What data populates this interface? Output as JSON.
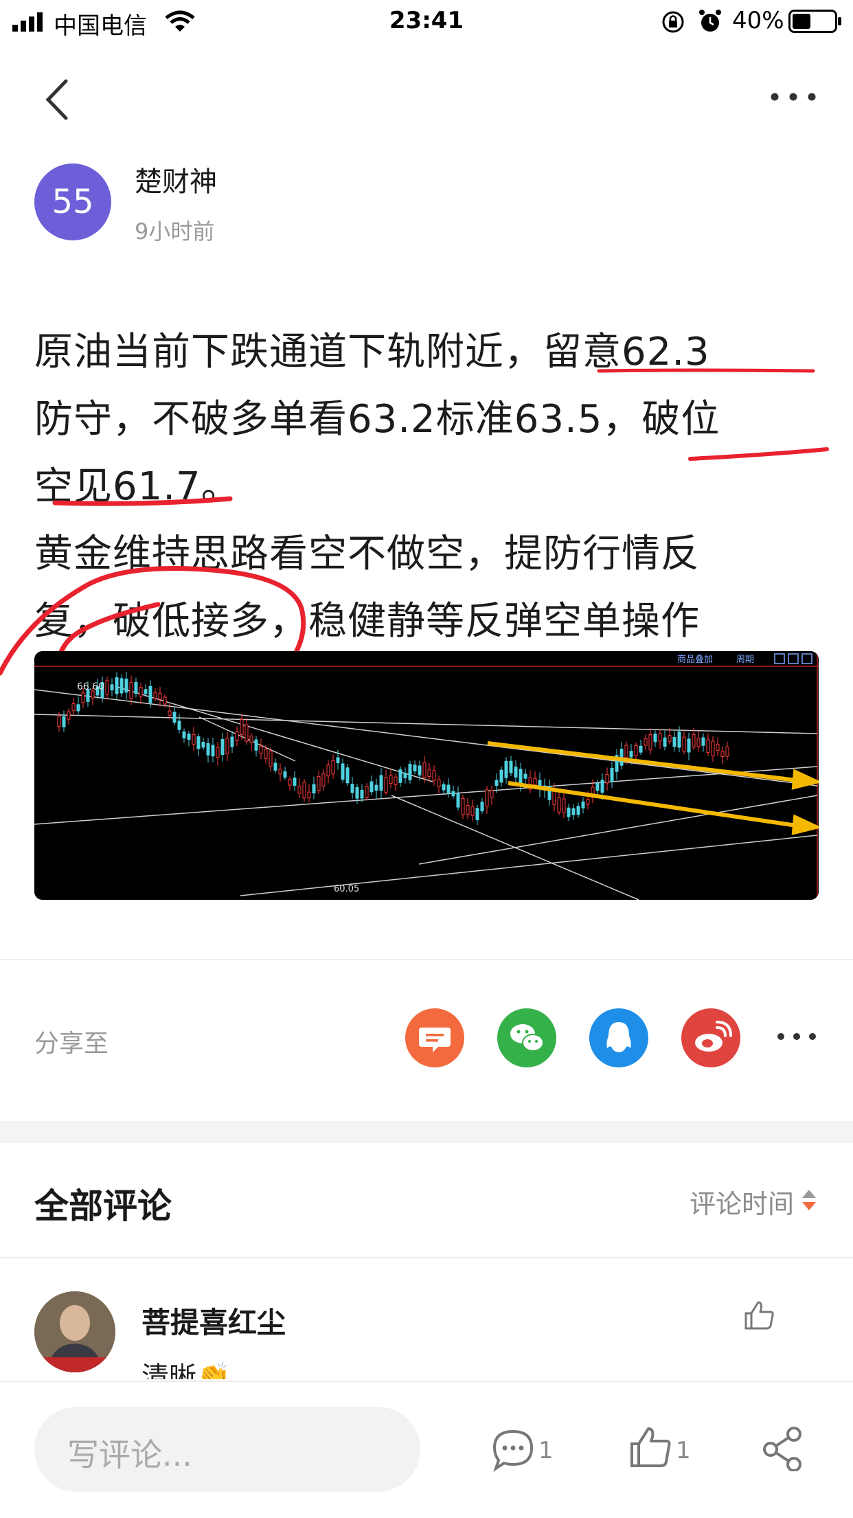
{
  "status_bar": {
    "carrier": "中国电信",
    "time": "23:41",
    "battery": "40%"
  },
  "nav": {
    "back_icon": "chevron-left-icon",
    "more_icon": "more-dots-icon"
  },
  "author": {
    "avatar_text": "55",
    "avatar_color": "#6d5fd7",
    "name": "楚财神",
    "time": "9小时前"
  },
  "post": {
    "lines": [
      "原油当前下跌通道下轨附近，留意62.3",
      "防守，不破多单看63.2标准63.5，破位",
      "空见61.7。",
      "黄金维持思路看空不做空，提防行情反",
      "复，破低接多，稳健静等反弹空单操作"
    ],
    "highlight_color": "#e8222e"
  },
  "chart": {
    "label_high": "66.60",
    "label_low": "60.05",
    "toolbar_1": "商品叠加",
    "toolbar_2": "周期",
    "arrow_color": "#f5b800"
  },
  "share": {
    "label": "分享至",
    "buttons": [
      {
        "name": "message-icon",
        "color": "#f26a3d"
      },
      {
        "name": "wechat-icon",
        "color": "#35b14a"
      },
      {
        "name": "qq-icon",
        "color": "#1e8ee8"
      },
      {
        "name": "weibo-icon",
        "color": "#e0443f"
      }
    ]
  },
  "comments": {
    "title": "全部评论",
    "sort_label": "评论时间",
    "items": [
      {
        "name": "菩提喜红尘",
        "text": "清晰👏"
      }
    ]
  },
  "bottom_bar": {
    "input_placeholder": "写评论...",
    "comment_count": "1",
    "like_count": "1"
  }
}
